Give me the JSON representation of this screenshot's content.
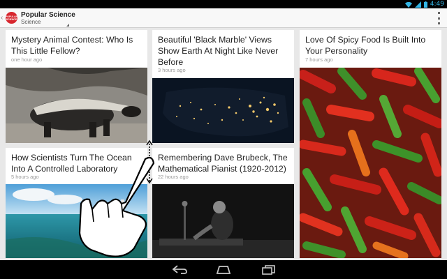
{
  "status_bar": {
    "time": "4:49",
    "icons": [
      "wifi-icon",
      "signal-icon",
      "battery-icon"
    ]
  },
  "action_bar": {
    "title": "Popular Science",
    "section": "Science",
    "logo_text": "POPULAR SCIENCE",
    "icons": [
      "up-caret-icon",
      "app-logo-icon",
      "dropdown-arrow-icon",
      "overflow-menu-icon"
    ]
  },
  "articles": [
    {
      "title": "Mystery Animal Contest: Who Is This Little Fellow?",
      "time": "one hour ago",
      "image": "honey-badger-photo"
    },
    {
      "title": "Beautiful 'Black Marble' Views Show Earth At Night Like Never Before",
      "time": "3 hours ago",
      "image": "earth-at-night-photo"
    },
    {
      "title": "Love Of Spicy Food Is Built Into Your Personality",
      "time": "7 hours ago",
      "image": "chili-peppers-photo"
    },
    {
      "title": "How Scientists Turn The Ocean Into A Controlled Laboratory",
      "time": "5 hours ago",
      "image": "ocean-laboratory-photo"
    },
    {
      "title": "Remembering Dave Brubeck, The Mathematical Pianist (1920-2012)",
      "time": "22 hours ago",
      "image": "pianist-photo"
    }
  ],
  "nav_bar": {
    "icons": [
      "back-icon",
      "home-icon",
      "recent-apps-icon"
    ]
  },
  "overlay": {
    "icons": [
      "hand-swipe-icon",
      "resize-handle-icon"
    ]
  },
  "colors": {
    "accent": "#33b5e5",
    "logo_red": "#d7262e",
    "background": "#e8e8e8"
  }
}
